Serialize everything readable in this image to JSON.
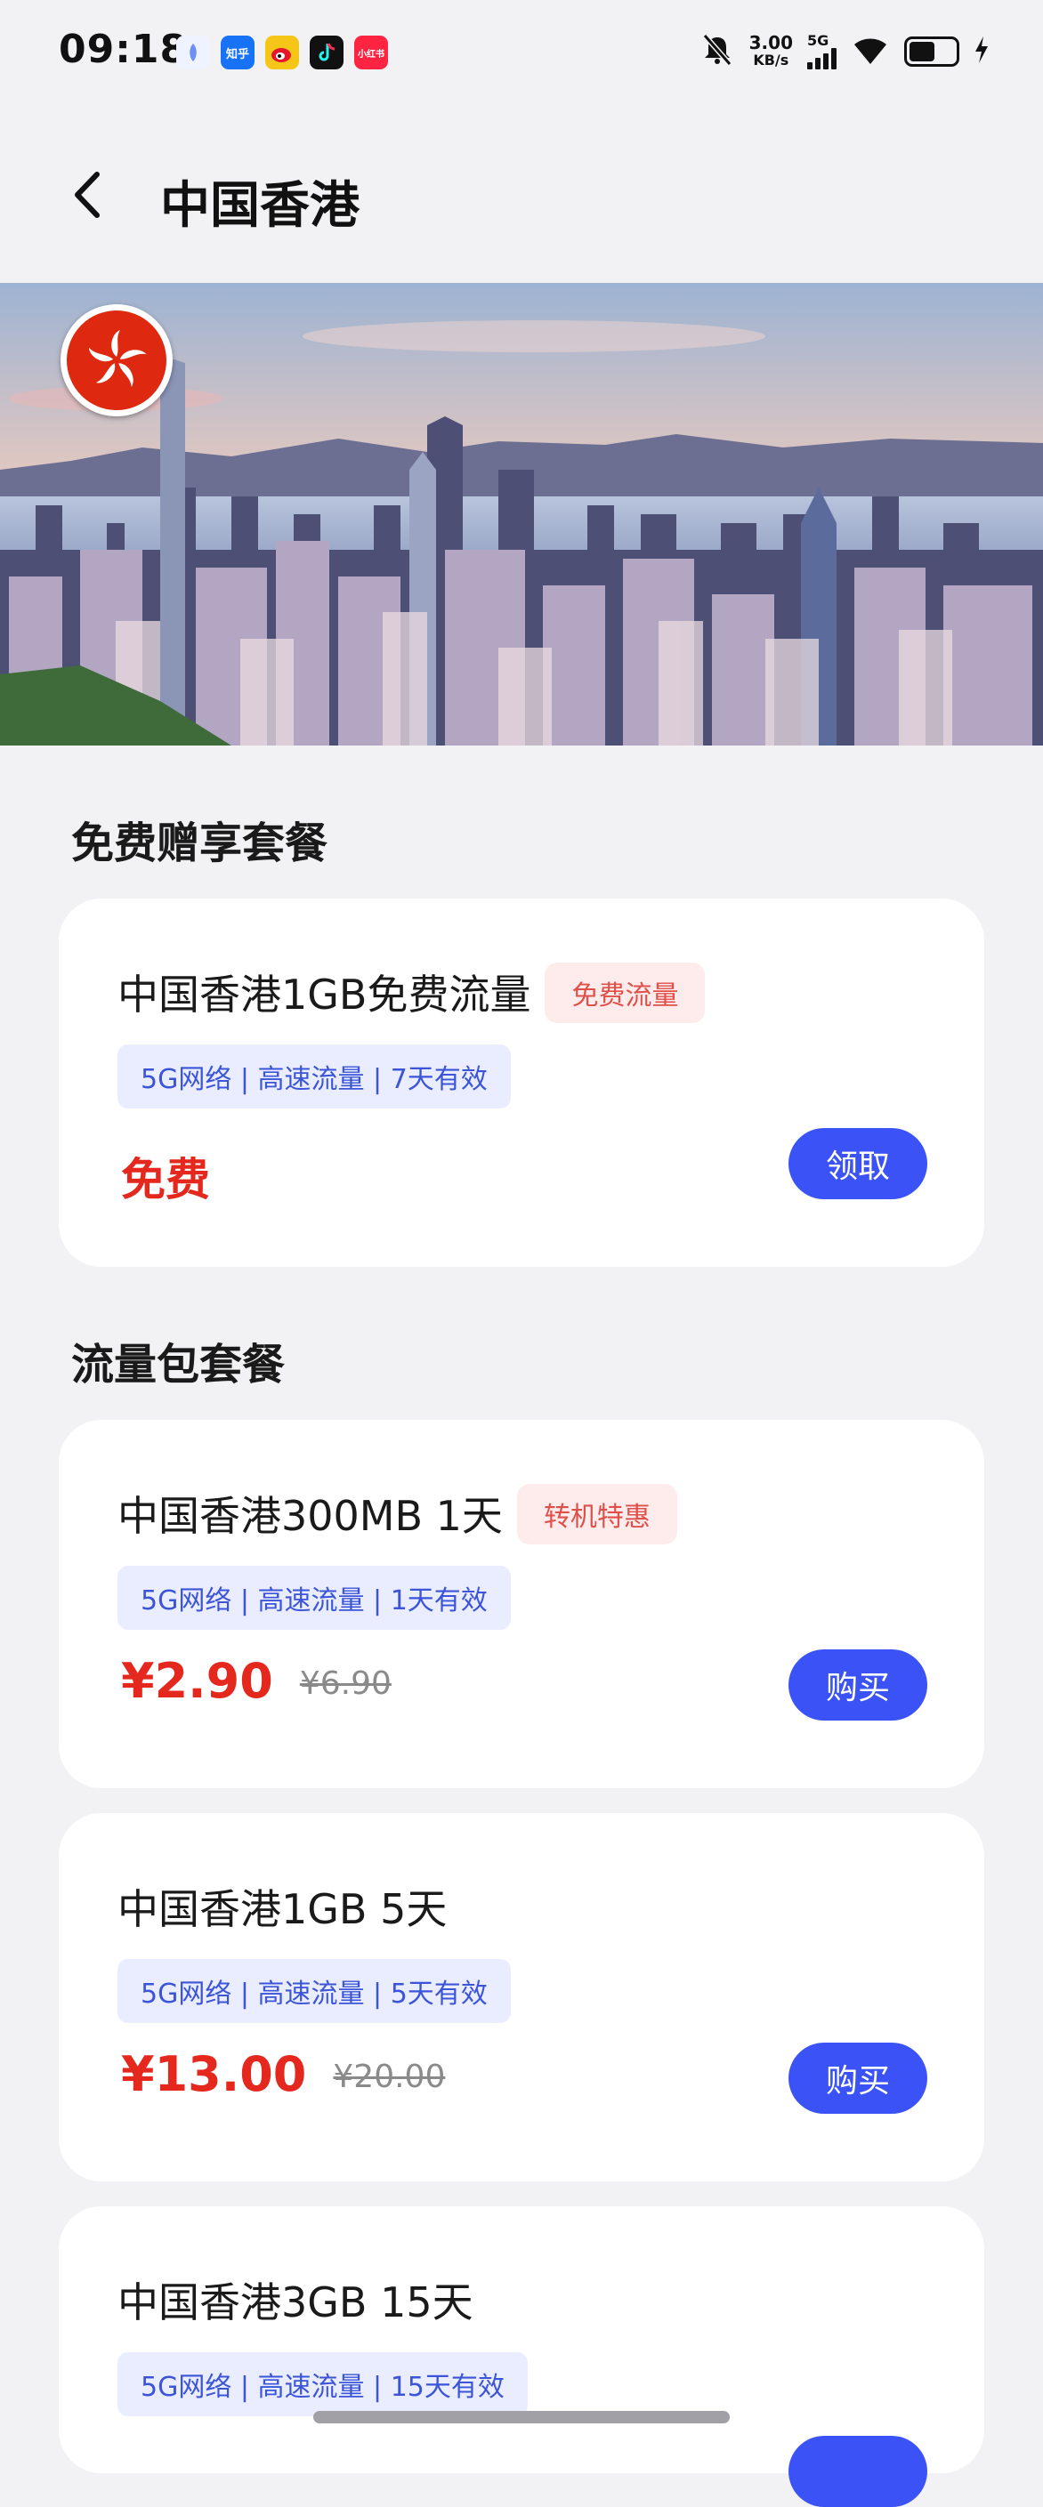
{
  "status_bar": {
    "time": "09:18",
    "apps": [
      {
        "name": "app-icon-1",
        "label": "",
        "color": "#eef3ff"
      },
      {
        "name": "zhihu-app-icon",
        "label": "知乎",
        "color": "#1772f6"
      },
      {
        "name": "weibo-app-icon",
        "label": "",
        "color": "#f5c518"
      },
      {
        "name": "douyin-app-icon",
        "label": "",
        "color": "#111111"
      },
      {
        "name": "xiaohongshu-app-icon",
        "label": "小红书",
        "color": "#ff2442"
      }
    ],
    "net_speed_value": "3.00",
    "net_speed_unit": "KB/s",
    "network_type": "5G"
  },
  "header": {
    "title": "中国香港"
  },
  "sections": {
    "free_title": "免费赠享套餐",
    "paid_title": "流量包套餐"
  },
  "free_plan": {
    "name": "中国香港1GB免费流量",
    "tag": "免费流量",
    "features": "5G网络 | 高速流量 | 7天有效",
    "price": "免费",
    "button": "领取"
  },
  "plans": [
    {
      "name": "中国香港300MB 1天",
      "tag": "转机特惠",
      "features": "5G网络 | 高速流量 | 1天有效",
      "price": "¥2.90",
      "original_price": "¥6.90",
      "button": "购买"
    },
    {
      "name": "中国香港1GB 5天",
      "features": "5G网络 | 高速流量 | 5天有效",
      "price": "¥13.00",
      "original_price": "¥20.00",
      "button": "购买"
    },
    {
      "name": "中国香港3GB 15天",
      "features": "5G网络 | 高速流量 | 15天有效"
    }
  ],
  "colors": {
    "accent": "#3b53f6",
    "price": "#e5281e",
    "tag_bg": "#fdeceb",
    "tag_text": "#e0504a",
    "feature_bg": "#e9edff",
    "feature_text": "#3c55d8",
    "flag": "#de2910"
  }
}
